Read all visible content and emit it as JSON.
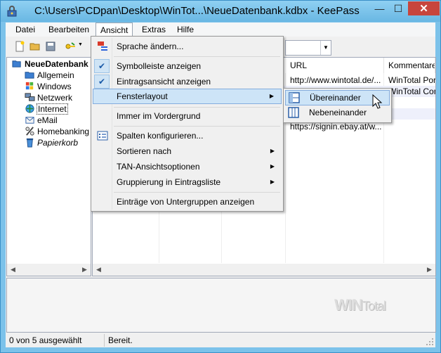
{
  "window": {
    "title": "C:\\Users\\PCDpan\\Desktop\\WinTot...\\NeueDatenbank.kdbx - KeePass",
    "close_glyph": "✕",
    "minimize_glyph": "—",
    "maximize_glyph": "☐"
  },
  "menubar": {
    "items": [
      "Datei",
      "Bearbeiten",
      "Ansicht",
      "Extras",
      "Hilfe"
    ]
  },
  "tree": {
    "root": "NeueDatenbank",
    "items": [
      "Allgemein",
      "Windows",
      "Netzwerk",
      "Internet",
      "eMail",
      "Homebanking",
      "Papierkorb"
    ]
  },
  "list": {
    "columns": [
      "URL",
      "Kommentare"
    ],
    "rows": [
      {
        "url": "http://www.wintotal.de/...",
        "comment": "WinTotal Porta"
      },
      {
        "url": "",
        "comment": "WinTotal Com"
      },
      {
        "url": "",
        "comment": ""
      },
      {
        "url": "",
        "comment": ""
      },
      {
        "url": "https://signin.ebay.at/w...",
        "comment": ""
      }
    ]
  },
  "menu": {
    "items": [
      {
        "label": "Sprache ändern..."
      },
      {
        "label": "Symbolleiste anzeigen"
      },
      {
        "label": "Eintragsansicht anzeigen"
      },
      {
        "label": "Fensterlayout"
      },
      {
        "label": "Immer im Vordergrund"
      },
      {
        "label": "Spalten konfigurieren..."
      },
      {
        "label": "Sortieren nach"
      },
      {
        "label": "TAN-Ansichtsoptionen"
      },
      {
        "label": "Gruppierung in Eintragsliste"
      },
      {
        "label": "Einträge von Untergruppen anzeigen"
      }
    ],
    "check_glyph": "✔",
    "submenu_glyph": "▶"
  },
  "submenu": {
    "items": [
      "Übereinander",
      "Nebeneinander"
    ]
  },
  "statusbar": {
    "selection": "0 von 5 ausgewählt",
    "state": "Bereit."
  },
  "watermark": {
    "main": "WIN",
    "suffix": "Total"
  },
  "colors": {
    "accent": "#3a8fc7",
    "highlight": "#cde4f7",
    "titlebar": "#7cc2ea"
  }
}
